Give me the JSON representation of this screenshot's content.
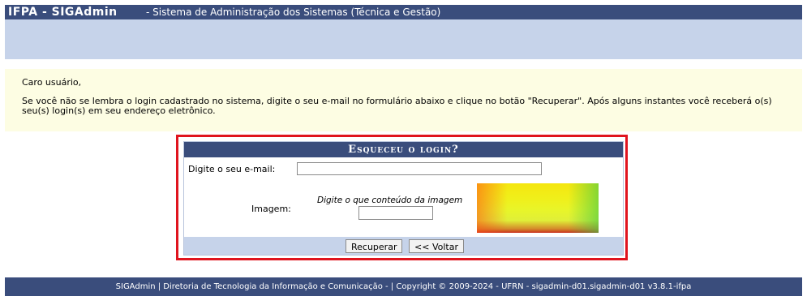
{
  "header": {
    "app_name": "IFPA - SIGAdmin",
    "subtitle": "- Sistema de Administração dos Sistemas (Técnica e Gestão)"
  },
  "info": {
    "greeting": "Caro usuário,",
    "message": "Se você não se lembra o login cadastrado no sistema, digite o seu e-mail no formulário abaixo e clique no botão \"Recuperar\". Após alguns instantes você receberá o(s) seu(s) login(s) em seu endereço eletrônico."
  },
  "form": {
    "title": "Esqueceu o login?",
    "email_label": "Digite o seu e-mail:",
    "email_value": "",
    "image_label": "Imagem:",
    "image_hint": "Digite o que conteúdo da imagem",
    "captcha_value": "",
    "recover_button": "Recuperar",
    "back_button": "<< Voltar"
  },
  "footer": {
    "text": "SIGAdmin | Diretoria de Tecnologia da Informação e Comunicação - | Copyright © 2009-2024 - UFRN - sigadmin-d01.sigadmin-d01 v3.8.1-ifpa"
  },
  "colors": {
    "header_bg": "#3a4d7c",
    "band_bg": "#c6d3ea",
    "info_bg": "#fdfde3",
    "highlight_border": "#e0141e"
  }
}
